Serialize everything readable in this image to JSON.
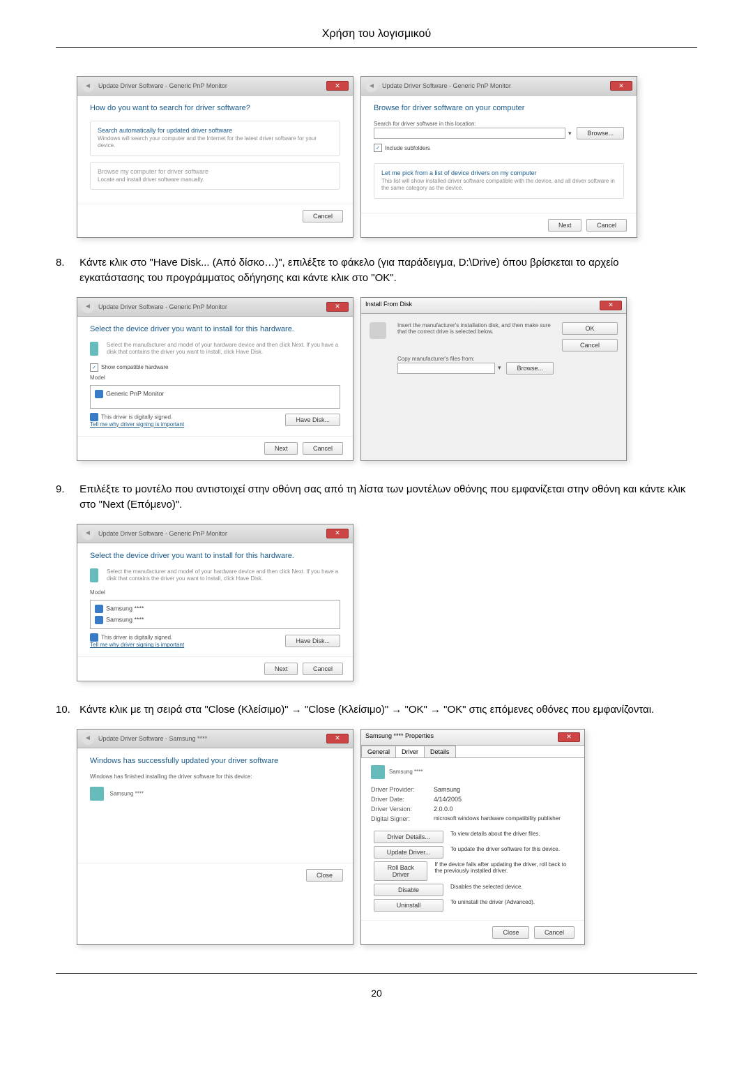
{
  "page_header": "Χρήση του λογισμικού",
  "page_number": "20",
  "steps": {
    "s8": {
      "num": "8.",
      "text": "Κάντε κλικ στο \"Have Disk... (Aπό δίσκο…)\", επιλέξτε το φάκελο (για παράδειγμα, D:\\Drive) όπου βρίσκεται το αρχείο εγκατάστασης του προγράμματος οδήγησης και κάντε κλικ στο \"OK\"."
    },
    "s9": {
      "num": "9.",
      "text": "Επιλέξτε το μοντέλο που αντιστοιχεί στην οθόνη σας από τη λίστα των μοντέλων οθόνης που εμφανίζεται στην οθόνη και κάντε κλικ στο \"Next (Επόμενο)\"."
    },
    "s10": {
      "num": "10.",
      "text": "Κάντε κλικ με τη σειρά στα \"Close (Kλείσιμο)\" → \"Close (Kλείσιμο)\" → \"OK\" → \"OK\" στις επόμενες οθόνες που εμφανίζονται."
    }
  },
  "win": {
    "update_title": "Update Driver Software - Generic PnP Monitor",
    "how_search": "How do you want to search for driver software?",
    "auto_title": "Search automatically for updated driver software",
    "auto_desc": "Windows will search your computer and the Internet for the latest driver software for your device.",
    "browse_title": "Browse my computer for driver software",
    "browse_desc": "Locate and install driver software manually.",
    "cancel": "Cancel",
    "browse_heading": "Browse for driver software on your computer",
    "search_loc": "Search for driver software in this location:",
    "browse_btn": "Browse...",
    "include_sub": "Include subfolders",
    "pick_title": "Let me pick from a list of device drivers on my computer",
    "pick_desc": "This list will show installed driver software compatible with the device, and all driver software in the same category as the device.",
    "next": "Next",
    "select_heading": "Select the device driver you want to install for this hardware.",
    "select_desc": "Select the manufacturer and model of your hardware device and then click Next. If you have a disk that contains the driver you want to install, click Have Disk.",
    "show_compat": "Show compatible hardware",
    "model_header": "Model",
    "generic_model": "Generic PnP Monitor",
    "samsung_model": "Samsung ****",
    "signed": "This driver is digitally signed.",
    "tell_me": "Tell me why driver signing is important",
    "have_disk": "Have Disk...",
    "install_from_disk": "Install From Disk",
    "insert_manuf": "Insert the manufacturer's installation disk, and then make sure that the correct drive is selected below.",
    "ok": "OK",
    "copy_files": "Copy manufacturer's files from:",
    "success": "Windows has successfully updated your driver software",
    "finished_install": "Windows has finished installing the driver software for this device:",
    "close": "Close",
    "properties_title": "Samsung **** Properties",
    "tab_general": "General",
    "tab_driver": "Driver",
    "tab_details": "Details",
    "driver_provider": "Driver Provider:",
    "driver_provider_v": "Samsung",
    "driver_date": "Driver Date:",
    "driver_date_v": "4/14/2005",
    "driver_version": "Driver Version:",
    "driver_version_v": "2.0.0.0",
    "digital_signer": "Digital Signer:",
    "digital_signer_v": "microsoft windows hardware compatibility publisher",
    "driver_details": "Driver Details...",
    "driver_details_desc": "To view details about the driver files.",
    "update_driver": "Update Driver...",
    "update_driver_desc": "To update the driver software for this device.",
    "rollback": "Roll Back Driver",
    "rollback_desc": "If the device fails after updating the driver, roll back to the previously installed driver.",
    "disable": "Disable",
    "disable_desc": "Disables the selected device.",
    "uninstall": "Uninstall",
    "uninstall_desc": "To uninstall the driver (Advanced)."
  }
}
